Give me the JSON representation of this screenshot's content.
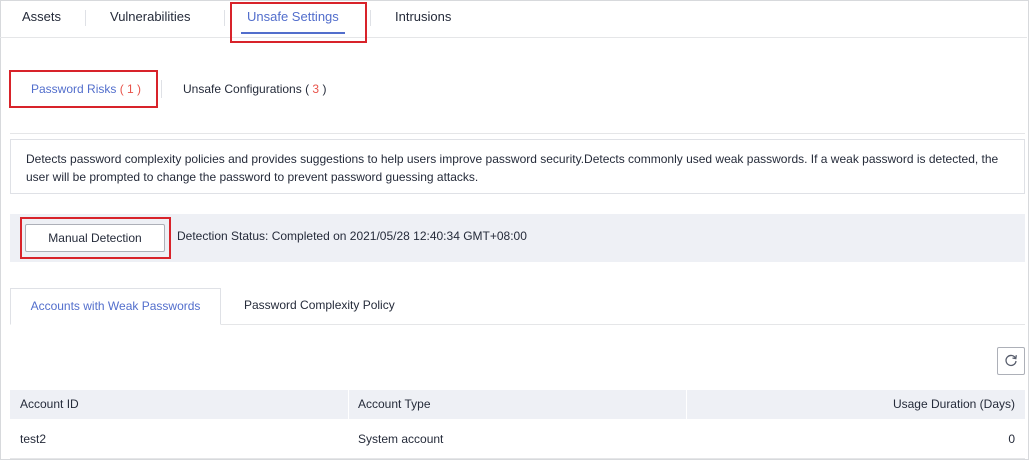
{
  "top_tabs": [
    {
      "label": "Assets"
    },
    {
      "label": "Vulnerabilities"
    },
    {
      "label": "Unsafe Settings",
      "active": true
    },
    {
      "label": "Intrusions"
    }
  ],
  "sub_tabs": {
    "password_risks": {
      "label": "Password Risks",
      "count": "( 1 )"
    },
    "unsafe_configurations": {
      "label": "Unsafe Configurations",
      "count_open": "( ",
      "count": "3",
      "count_close": " )"
    }
  },
  "description": "Detects password complexity policies and provides suggestions to help users improve password security.Detects commonly used weak passwords. If a weak password is detected, the user will be prompted to change the password to prevent password guessing attacks.",
  "detection": {
    "button_label": "Manual Detection",
    "status": "Detection Status: Completed on 2021/05/28 12:40:34 GMT+08:00"
  },
  "card_tabs": [
    {
      "label": "Accounts with Weak Passwords",
      "active": true
    },
    {
      "label": "Password Complexity Policy"
    }
  ],
  "refresh_icon": "refresh-icon",
  "table": {
    "columns": [
      "Account ID",
      "Account Type",
      "Usage Duration (Days)"
    ],
    "rows": [
      {
        "account_id": "test2",
        "account_type": "System account",
        "usage_duration": "0"
      }
    ]
  },
  "colors": {
    "accent": "#526ecc",
    "highlight_box": "#d8232a",
    "count": "#e8534a"
  }
}
